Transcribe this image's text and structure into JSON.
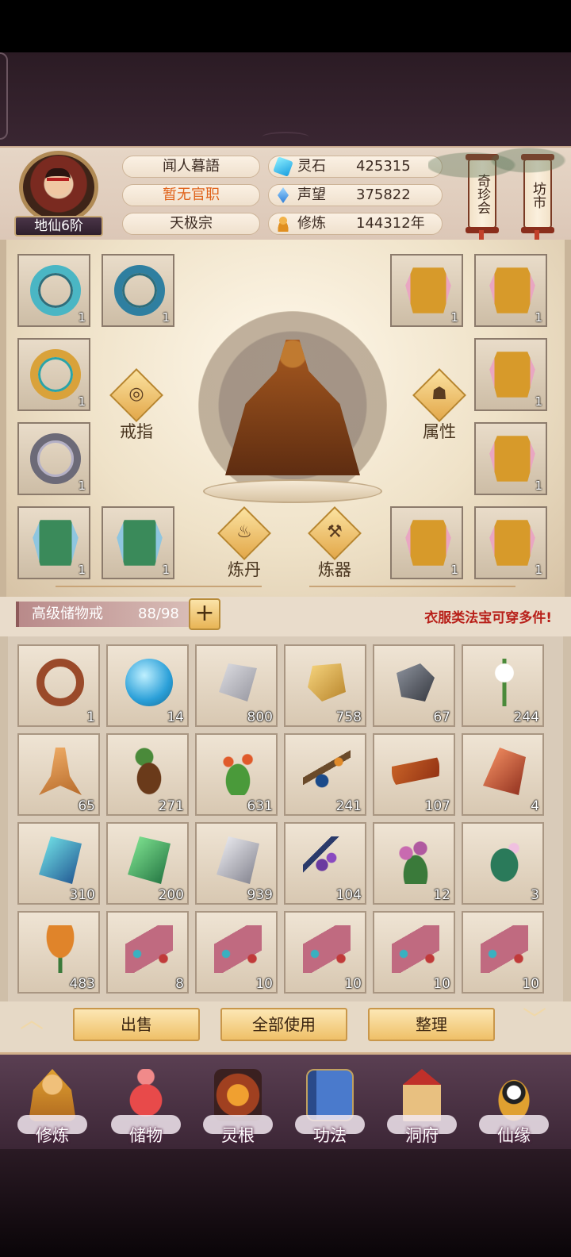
{
  "player": {
    "name": "闻人暮語",
    "official_rank": "暂无官职",
    "sect": "天极宗",
    "realm": "地仙6阶"
  },
  "resources": [
    {
      "label": "灵石",
      "value": "425315",
      "icon": "spirit-stone-icon"
    },
    {
      "label": "声望",
      "value": "375822",
      "icon": "reputation-icon"
    },
    {
      "label": "修炼",
      "value": "144312年",
      "icon": "cultivation-icon"
    }
  ],
  "side_menu": {
    "treasure_hall": "奇珍会",
    "market": "坊市"
  },
  "equipment": {
    "ring_label": "戒指",
    "attr_label": "属性",
    "alchemy_label": "炼丹",
    "forge_label": "炼器",
    "left_slots": [
      {
        "item": "jade-ring",
        "count": "1"
      },
      {
        "item": "blue-ring",
        "count": "1"
      },
      {
        "item": "gold-ring",
        "count": "1"
      },
      {
        "item": "pearl-ring",
        "count": "1"
      },
      {
        "item": "feather-robe",
        "count": "1"
      },
      {
        "item": "feather-robe",
        "count": "1"
      }
    ],
    "right_slots": [
      {
        "item": "golden-robe",
        "count": "1"
      },
      {
        "item": "golden-robe",
        "count": "1"
      },
      {
        "item": "golden-robe",
        "count": "1"
      },
      {
        "item": "golden-robe",
        "count": "1"
      },
      {
        "item": "golden-robe",
        "count": "1"
      },
      {
        "item": "golden-robe",
        "count": "1"
      }
    ]
  },
  "storage": {
    "title": "高级储物戒",
    "capacity": "88/98",
    "add_label": "+",
    "notice": "衣服类法宝可穿多件!"
  },
  "inventory": [
    {
      "item": "agate-ring",
      "count": "1"
    },
    {
      "item": "spirit-orb",
      "count": "14"
    },
    {
      "item": "grey-ore",
      "count": "800"
    },
    {
      "item": "gold-ore",
      "count": "758"
    },
    {
      "item": "dark-ore",
      "count": "67"
    },
    {
      "item": "white-lily",
      "count": "244"
    },
    {
      "item": "ginseng-root",
      "count": "65"
    },
    {
      "item": "seed-pods",
      "count": "271"
    },
    {
      "item": "red-herb",
      "count": "631"
    },
    {
      "item": "fruit-branch",
      "count": "241"
    },
    {
      "item": "caterpillar-fungus",
      "count": "107"
    },
    {
      "item": "red-crystal",
      "count": "4"
    },
    {
      "item": "cyan-crystal",
      "count": "310"
    },
    {
      "item": "green-crystal",
      "count": "200"
    },
    {
      "item": "silver-crystal",
      "count": "939"
    },
    {
      "item": "purple-berries",
      "count": "104"
    },
    {
      "item": "lavender-herb",
      "count": "12"
    },
    {
      "item": "fern-herb",
      "count": "3"
    },
    {
      "item": "lotus-pod",
      "count": "483"
    },
    {
      "item": "beaded-scroll",
      "count": "8"
    },
    {
      "item": "beaded-scroll",
      "count": "10"
    },
    {
      "item": "beaded-scroll",
      "count": "10"
    },
    {
      "item": "beaded-scroll",
      "count": "10"
    },
    {
      "item": "beaded-scroll",
      "count": "10"
    }
  ],
  "actions": {
    "sell": "出售",
    "use_all": "全部使用",
    "sort": "整理"
  },
  "nav": [
    {
      "label": "修炼",
      "icon": "cultivate-icon"
    },
    {
      "label": "储物",
      "icon": "storage-bag-icon"
    },
    {
      "label": "灵根",
      "icon": "spirit-root-icon"
    },
    {
      "label": "功法",
      "icon": "technique-book-icon"
    },
    {
      "label": "洞府",
      "icon": "cave-dwelling-icon"
    },
    {
      "label": "仙缘",
      "icon": "immortal-fate-icon"
    }
  ]
}
